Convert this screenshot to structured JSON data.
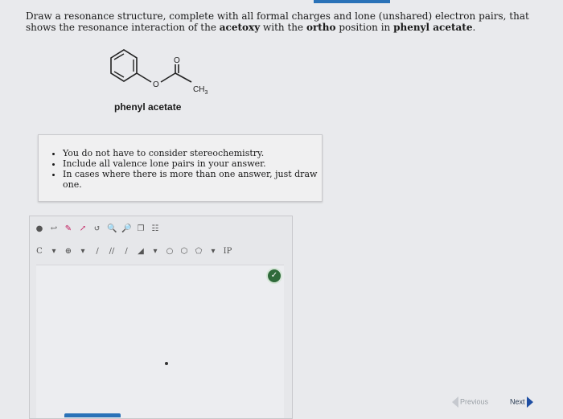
{
  "question": {
    "p1": "Draw a resonance structure, complete with all formal charges and lone (unshared) electron pairs, that shows the resonance interaction of the ",
    "b1": "acetoxy",
    "p2": " with the ",
    "b2": "ortho",
    "p3": " position in ",
    "b3": "phenyl acetate",
    "p4": "."
  },
  "molecule": {
    "o_label": "O",
    "carbonyl_o_label": "O",
    "ch3_label": "CH",
    "ch3_sub": "3",
    "caption": "phenyl acetate"
  },
  "notes": {
    "items": [
      "You do not have to consider stereochemistry.",
      "Include all valence lone pairs in your answer.",
      "In cases where there is more than one answer, just draw one."
    ]
  },
  "editor": {
    "toolbar_row2": {
      "element_label": "C",
      "marker": "IP"
    }
  },
  "nav": {
    "previous": "Previous",
    "next": "Next"
  }
}
